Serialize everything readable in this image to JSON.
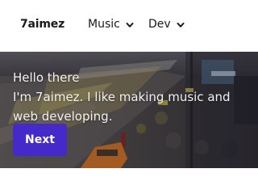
{
  "navbar": {
    "brand": "7aimez",
    "items": [
      {
        "label": "Music",
        "icon": "chevron-down-icon"
      },
      {
        "label": "Dev",
        "icon": "chevron-down-icon"
      }
    ]
  },
  "hero": {
    "greeting": "Hello there",
    "intro": "I'm 7aimez. I like making music and web developing.",
    "next_label": "Next",
    "colors": {
      "button": "#4629c9"
    }
  }
}
